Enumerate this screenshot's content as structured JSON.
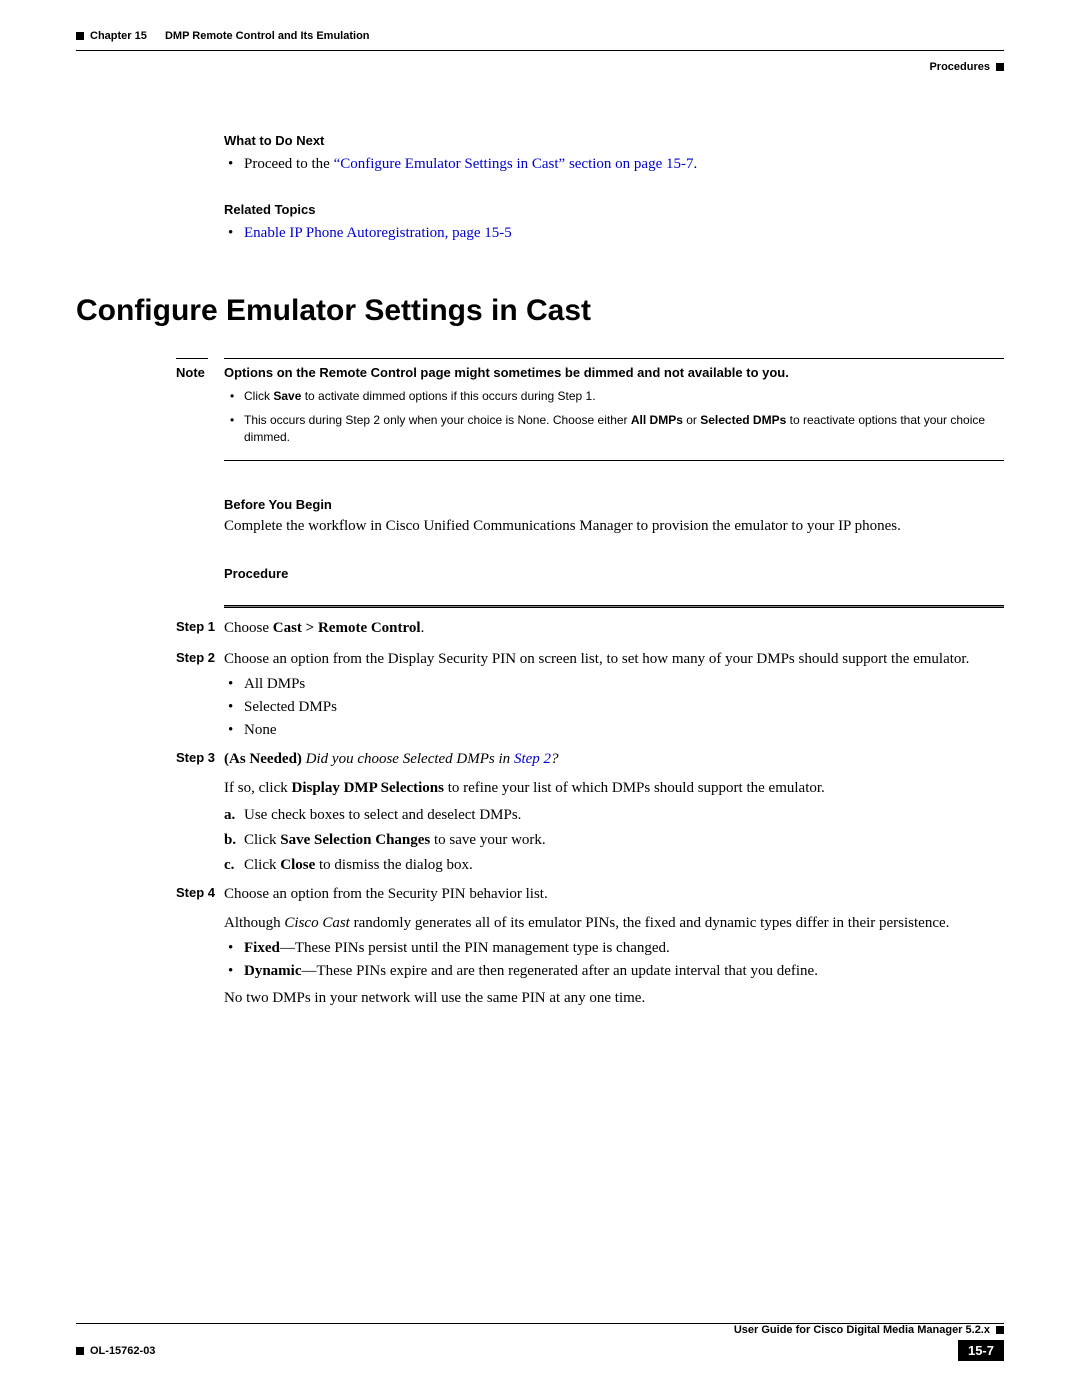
{
  "header": {
    "chapter": "Chapter 15",
    "chapter_title": "DMP Remote Control and Its Emulation",
    "section": "Procedures"
  },
  "what_next": {
    "label": "What to Do Next",
    "item_prefix": "Proceed to the ",
    "item_link": "“Configure Emulator Settings in Cast” section on page 15-7",
    "item_suffix": "."
  },
  "related": {
    "label": "Related Topics",
    "item": "Enable IP Phone Autoregistration, page 15-5"
  },
  "heading": "Configure Emulator Settings in Cast",
  "note": {
    "label": "Note",
    "lead": "Options on the Remote Control page might sometimes be dimmed and not available to you.",
    "b1_a": "Click ",
    "b1_bold": "Save",
    "b1_b": " to activate dimmed options if this occurs during Step 1.",
    "b2_a": "This occurs during Step 2 only when your choice is None. Choose either ",
    "b2_bold1": "All DMPs",
    "b2_mid": " or ",
    "b2_bold2": "Selected DMPs",
    "b2_b": " to reactivate options that your choice dimmed."
  },
  "before": {
    "label": "Before You Begin",
    "text": "Complete the workflow in Cisco Unified Communications Manager to provision the emulator to your IP phones."
  },
  "procedure_label": "Procedure",
  "steps": {
    "s1_label": "Step 1",
    "s1_a": "Choose ",
    "s1_bold": "Cast > Remote Control",
    "s1_b": ".",
    "s2_label": "Step 2",
    "s2": "Choose an option from the Display Security PIN on screen list, to set how many of your DMPs should support the emulator.",
    "s2_opts": [
      "All DMPs",
      "Selected DMPs",
      "None"
    ],
    "s3_label": "Step 3",
    "s3_asneeded": "(As Needed)",
    "s3_italic_a": " Did you choose Selected DMPs in ",
    "s3_link": "Step 2",
    "s3_italic_b": "?",
    "s3_p_a": "If so, click ",
    "s3_p_bold": "Display DMP Selections",
    "s3_p_b": " to refine your list of which DMPs should support the emulator.",
    "s3_a_label": "a.",
    "s3_a": "Use check boxes to select and deselect DMPs.",
    "s3_b_label": "b.",
    "s3_b_a": "Click ",
    "s3_b_bold": "Save Selection Changes",
    "s3_b_b": " to save your work.",
    "s3_c_label": "c.",
    "s3_c_a": "Click ",
    "s3_c_bold": "Close",
    "s3_c_b": " to dismiss the dialog box.",
    "s4_label": "Step 4",
    "s4": "Choose an option from the Security PIN behavior list.",
    "s4_p_a": "Although ",
    "s4_p_italic": "Cisco Cast",
    "s4_p_b": " randomly generates all of its emulator PINs, the fixed and dynamic types differ in their persistence.",
    "s4_fixed_label": "Fixed",
    "s4_fixed": "—These PINs persist until the PIN management type is changed.",
    "s4_dyn_label": "Dynamic",
    "s4_dyn": "—These PINs expire and are then regenerated after an update interval that you define.",
    "s4_last": "No two DMPs in your network will use the same PIN at any one time."
  },
  "footer": {
    "doc_title": "User Guide for Cisco Digital Media Manager 5.2.x",
    "doc_id": "OL-15762-03",
    "page_num": "15-7"
  }
}
